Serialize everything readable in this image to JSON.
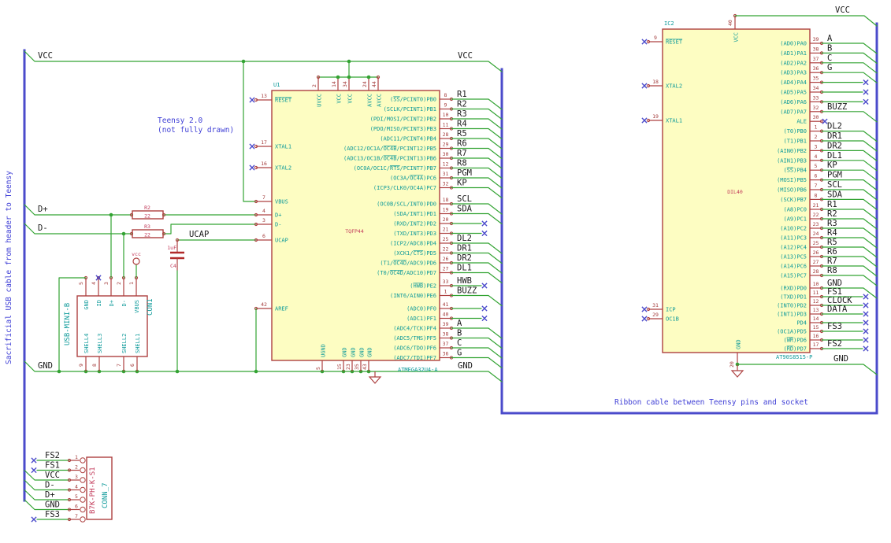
{
  "notes": {
    "sacrificial": "Sacrificial USB cable from header to Teensy",
    "teensy_line1": "Teensy 2.0",
    "teensy_line2": "(not fully drawn)",
    "ribbon": "Ribbon cable between Teensy pins and socket"
  },
  "power_labels": {
    "vcc_left": "VCC",
    "vcc_u1": "VCC",
    "gnd_left": "GND",
    "gnd_u1": "GND",
    "vcc_ic2": "VCC",
    "gnd_ic2": "GND",
    "ucap": "UCAP",
    "dplus": "D+",
    "dminus": "D-",
    "vbus_power": "vcc"
  },
  "u1": {
    "ref": "U1",
    "value": "ATMEGA32U4-A",
    "footprint": "TQFP44",
    "left_pins": [
      {
        "num": "13",
        "name": "~RESET~",
        "nc": true
      },
      {
        "num": "17",
        "name": "XTAL1",
        "nc": true
      },
      {
        "num": "16",
        "name": "XTAL2",
        "nc": true
      },
      {
        "num": "7",
        "name": "VBUS"
      },
      {
        "num": "4",
        "name": "D+"
      },
      {
        "num": "3",
        "name": "D-"
      },
      {
        "num": "6",
        "name": "UCAP"
      },
      {
        "num": "42",
        "name": "AREF"
      }
    ],
    "top_pins": [
      {
        "num": "2",
        "name": "UVCC"
      },
      {
        "num": "14",
        "name": "VCC"
      },
      {
        "num": "34",
        "name": "VCC"
      },
      {
        "num": "24",
        "name": "AVCC"
      },
      {
        "num": "44",
        "name": "AVCC"
      }
    ],
    "bottom_pins": [
      {
        "num": "5",
        "name": "UGND"
      },
      {
        "num": "15",
        "name": "GND"
      },
      {
        "num": "23",
        "name": "GND"
      },
      {
        "num": "35",
        "name": "GND"
      },
      {
        "num": "43",
        "name": "GND"
      }
    ],
    "right_groups": [
      {
        "pins": [
          {
            "num": "8",
            "name": "(~SS~/PCINT0)PB0",
            "label": "R1",
            "to": "bus"
          },
          {
            "num": "9",
            "name": "(SCLK/PCINT1)PB1",
            "label": "R2",
            "to": "bus"
          },
          {
            "num": "10",
            "name": "(PDI/MOSI/PCINT2)PB2",
            "label": "R3",
            "to": "bus"
          },
          {
            "num": "11",
            "name": "(PDO/MISO/PCINT3)PB3",
            "label": "R4",
            "to": "bus"
          },
          {
            "num": "28",
            "name": "(ADC11/PCINT4)PB4",
            "label": "R5",
            "to": "bus"
          },
          {
            "num": "29",
            "name": "(ADC12/OC1A/~OC4B~/PCINT12)PB5",
            "label": "R6",
            "to": "bus"
          },
          {
            "num": "30",
            "name": "(ADC13/OC1B/~OC4B~/PCINT13)PB6",
            "label": "R7",
            "to": "bus"
          },
          {
            "num": "12",
            "name": "(OC0A/OC1C/~RTS~/PCINT7)PB7",
            "label": "R8",
            "to": "bus"
          }
        ]
      },
      {
        "pins": [
          {
            "num": "31",
            "name": "(OC3A/~OC4A~)PC6",
            "label": "PGM",
            "to": "bus"
          },
          {
            "num": "32",
            "name": "(ICP3/CLK0/OC4A)PC7",
            "label": "KP",
            "to": "bus"
          }
        ]
      },
      {
        "pins": [
          {
            "num": "18",
            "name": "(OC0B/SCL/INT0)PD0",
            "label": "SCL",
            "to": "bus"
          },
          {
            "num": "19",
            "name": "(SDA/INT1)PD1",
            "label": "SDA",
            "to": "bus"
          },
          {
            "num": "20",
            "name": "(RXD/INT2)PD2",
            "label": "",
            "to": "nc"
          },
          {
            "num": "21",
            "name": "(TXD/INT3)PD3",
            "label": "",
            "to": "nc"
          },
          {
            "num": "25",
            "name": "(ICP2/ADC8)PD4",
            "label": "DL2",
            "to": "bus"
          },
          {
            "num": "22",
            "name": "(XCK1/~CTS~)PD5",
            "label": "DR1",
            "to": "bus"
          },
          {
            "num": "26",
            "name": "(T1/~OC4D~/ADC9)PD6",
            "label": "DR2",
            "to": "bus"
          },
          {
            "num": "27",
            "name": "(T0/~OC4D~/ADC10)PD7",
            "label": "DL1",
            "to": "bus"
          }
        ]
      },
      {
        "pins": [
          {
            "num": "33",
            "name": "(~HWB~)PE2",
            "label": "HWB",
            "to": "nc"
          },
          {
            "num": "1",
            "name": "(INT6/AIN0)PE6",
            "label": "BUZZ",
            "to": "bus"
          }
        ]
      },
      {
        "pins": [
          {
            "num": "41",
            "name": "(ADC0)PF0",
            "label": "",
            "to": "nc"
          },
          {
            "num": "40",
            "name": "(ADC1)PF1",
            "label": "",
            "to": "nc"
          },
          {
            "num": "39",
            "name": "(ADC4/TCK)PF4",
            "label": "A",
            "to": "bus"
          },
          {
            "num": "38",
            "name": "(ADC5/TMS)PF5",
            "label": "B",
            "to": "bus"
          },
          {
            "num": "37",
            "name": "(ADC6/TDO)PF6",
            "label": "C",
            "to": "bus"
          },
          {
            "num": "36",
            "name": "(ADC7/TDI)PF7",
            "label": "G",
            "to": "bus"
          }
        ]
      }
    ]
  },
  "ic2": {
    "ref": "IC2",
    "value": "AT90S8515-P",
    "footprint": "DIL40",
    "left_pins": [
      {
        "num": "9",
        "name": "~RESET~",
        "nc": true
      },
      {
        "num": "18",
        "name": "XTAL2",
        "nc": true
      },
      {
        "num": "19",
        "name": "XTAL1",
        "nc": true
      },
      {
        "num": "31",
        "name": "ICP",
        "nc": true
      },
      {
        "num": "29",
        "name": "OC1B",
        "nc": true
      }
    ],
    "top_pins": [
      {
        "num": "40",
        "name": "VCC"
      }
    ],
    "bottom_pins": [
      {
        "num": "20",
        "name": "GND"
      }
    ],
    "right_groups": [
      {
        "pins": [
          {
            "num": "39",
            "name": "(AD0)PA0",
            "label": "A",
            "to": "bus"
          },
          {
            "num": "38",
            "name": "(AD1)PA1",
            "label": "B",
            "to": "bus"
          },
          {
            "num": "37",
            "name": "(AD2)PA2",
            "label": "C",
            "to": "bus"
          },
          {
            "num": "36",
            "name": "(AD3)PA3",
            "label": "G",
            "to": "bus"
          },
          {
            "num": "35",
            "name": "(AD4)PA4",
            "label": "",
            "to": "nc"
          },
          {
            "num": "34",
            "name": "(AD5)PA5",
            "label": "",
            "to": "nc"
          },
          {
            "num": "33",
            "name": "(AD6)PA6",
            "label": "",
            "to": "nc"
          },
          {
            "num": "32",
            "name": "(AD7)PA7",
            "label": "BUZZ",
            "to": "bus"
          }
        ]
      },
      {
        "pins": [
          {
            "num": "30",
            "name": "ALE",
            "label": "",
            "to": "nc-pin"
          }
        ]
      },
      {
        "pins": [
          {
            "num": "1",
            "name": "(T0)PB0",
            "label": "DL2",
            "to": "bus"
          },
          {
            "num": "2",
            "name": "(T1)PB1",
            "label": "DR1",
            "to": "bus"
          },
          {
            "num": "3",
            "name": "(AIN0)PB2",
            "label": "DR2",
            "to": "bus"
          },
          {
            "num": "4",
            "name": "(AIN1)PB3",
            "label": "DL1",
            "to": "bus"
          },
          {
            "num": "5",
            "name": "(~SS~)PB4",
            "label": "KP",
            "to": "bus"
          },
          {
            "num": "6",
            "name": "(MOSI)PB5",
            "label": "PGM",
            "to": "bus"
          },
          {
            "num": "7",
            "name": "(MISO)PB6",
            "label": "SCL",
            "to": "bus"
          },
          {
            "num": "8",
            "name": "(SCK)PB7",
            "label": "SDA",
            "to": "bus"
          }
        ]
      },
      {
        "pins": [
          {
            "num": "21",
            "name": "(A8)PC0",
            "label": "R1",
            "to": "bus"
          },
          {
            "num": "22",
            "name": "(A9)PC1",
            "label": "R2",
            "to": "bus"
          },
          {
            "num": "23",
            "name": "(A10)PC2",
            "label": "R3",
            "to": "bus"
          },
          {
            "num": "24",
            "name": "(A11)PC3",
            "label": "R4",
            "to": "bus"
          },
          {
            "num": "25",
            "name": "(A12)PC4",
            "label": "R5",
            "to": "bus"
          },
          {
            "num": "26",
            "name": "(A13)PC5",
            "label": "R6",
            "to": "bus"
          },
          {
            "num": "27",
            "name": "(A14)PC6",
            "label": "R7",
            "to": "bus"
          },
          {
            "num": "28",
            "name": "(A15)PC7",
            "label": "R8",
            "to": "bus"
          }
        ]
      },
      {
        "pins": [
          {
            "num": "10",
            "name": "(RXD)PD0",
            "label": "GND",
            "to": "bus"
          },
          {
            "num": "11",
            "name": "(TXD)PD1",
            "label": "FS1",
            "to": "nc"
          },
          {
            "num": "12",
            "name": "(INT0)PD2",
            "label": "CLOCK",
            "to": "nc"
          },
          {
            "num": "13",
            "name": "(INT1)PD3",
            "label": "DATA",
            "to": "nc"
          },
          {
            "num": "14",
            "name": "PD4",
            "label": "",
            "to": "nc"
          },
          {
            "num": "15",
            "name": "(OC1A)PD5",
            "label": "FS3",
            "to": "nc"
          },
          {
            "num": "16",
            "name": "(~WR~)PD6",
            "label": "",
            "to": "nc"
          },
          {
            "num": "17",
            "name": "(~RD~)PD7",
            "label": "FS2",
            "to": "nc"
          }
        ]
      }
    ]
  },
  "con1": {
    "ref": "CON1",
    "value": "USB-MINI-B",
    "top_pins": [
      {
        "num": "5",
        "name": "GND"
      },
      {
        "num": "4",
        "name": "ID",
        "nc": true
      },
      {
        "num": "3",
        "name": "D+"
      },
      {
        "num": "2",
        "name": "D-"
      },
      {
        "num": "1",
        "name": "VBUS"
      }
    ],
    "bottom_pins": [
      {
        "num": "9",
        "name": "SHELL4"
      },
      {
        "num": "8",
        "name": "SHELL3"
      },
      {
        "num": "7",
        "name": "SHELL2"
      },
      {
        "num": "6",
        "name": "SHELL1"
      }
    ]
  },
  "conn7": {
    "ref": "CONN_7",
    "value": "B7K-PH-K-S1",
    "pins": [
      {
        "num": "1",
        "label": "FS2",
        "to": "nc"
      },
      {
        "num": "2",
        "label": "FS1",
        "to": "nc"
      },
      {
        "num": "3",
        "label": "VCC",
        "to": "bus"
      },
      {
        "num": "4",
        "label": "D-",
        "to": "bus"
      },
      {
        "num": "5",
        "label": "D+",
        "to": "bus"
      },
      {
        "num": "6",
        "label": "GND",
        "to": "bus"
      },
      {
        "num": "7",
        "label": "FS3",
        "to": "nc"
      }
    ]
  },
  "resistors": [
    {
      "ref": "R2",
      "value": "22"
    },
    {
      "ref": "R3",
      "value": "22"
    }
  ],
  "capacitor": {
    "ref": "C4",
    "value": "1uF"
  },
  "colors": {
    "wire": "#33a333",
    "bus": "#4b4bcb",
    "part_outline": "#ad4040",
    "part_fill": "#fdfdc2",
    "pin_name": "#0e9a9a",
    "pin_number": "#a33b3b",
    "net_label": "#1a1a1a",
    "note": "#4040d6",
    "field": "#c23a5a"
  }
}
